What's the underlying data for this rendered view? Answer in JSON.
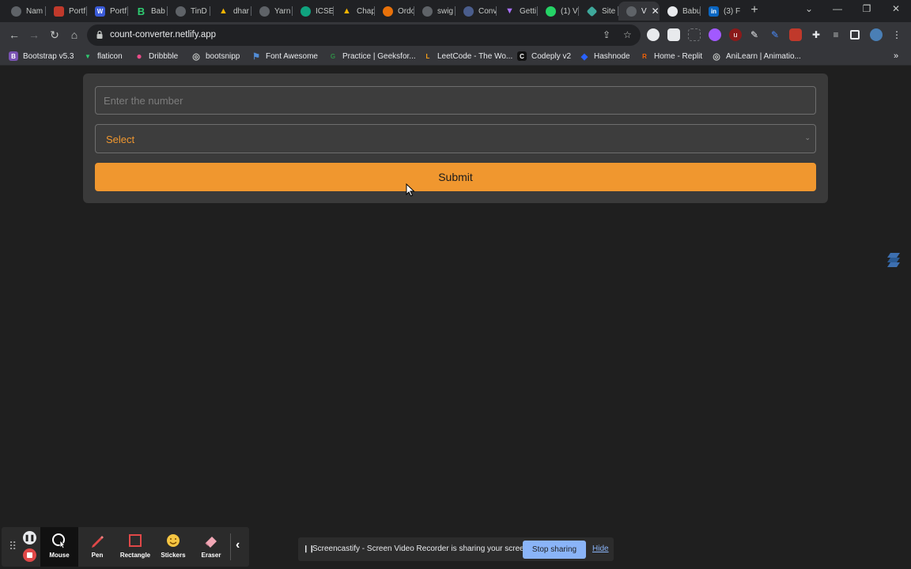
{
  "browser": {
    "tabs": [
      {
        "label": "Nam",
        "color": "#5f6368"
      },
      {
        "label": "Portf",
        "color": "#c0392b"
      },
      {
        "label": "Portf",
        "color": "#3a5bd9"
      },
      {
        "label": "Bab",
        "color": "#2ecc71"
      },
      {
        "label": "TinD",
        "color": "#5f6368"
      },
      {
        "label": "dhar",
        "color": "#f4b400"
      },
      {
        "label": "Yarn",
        "color": "#5f6368"
      },
      {
        "label": "ICSE",
        "color": "#10a37f"
      },
      {
        "label": "Chap",
        "color": "#f4b400"
      },
      {
        "label": "Ordo",
        "color": "#e8710a"
      },
      {
        "label": "swig",
        "color": "#5f6368"
      },
      {
        "label": "Conv",
        "color": "#4a5d8c"
      },
      {
        "label": "Getti",
        "color": "#8e44ad"
      },
      {
        "label": "(1) V",
        "color": "#25d366"
      },
      {
        "label": "Site",
        "color": "#3ea89b"
      },
      {
        "label": "V",
        "color": "#5f6368"
      },
      {
        "label": "Babu",
        "color": "#e8eaed"
      },
      {
        "label": "(3) F",
        "color": "#0a66c2"
      }
    ],
    "new_tab_label": "+",
    "url": "count-converter.netlify.app",
    "bookmarks": [
      {
        "label": "Bootstrap v5.3",
        "color": "#7952b3",
        "glyph": "B"
      },
      {
        "label": "flaticon",
        "color": "#2ecc71",
        "glyph": "▼"
      },
      {
        "label": "Dribbble",
        "color": "#ea4c89",
        "glyph": "●"
      },
      {
        "label": "bootsnipp",
        "color": "#5f6368",
        "glyph": "◎"
      },
      {
        "label": "Font Awesome",
        "color": "#528dd7",
        "glyph": "⚑"
      },
      {
        "label": "Practice | Geeksfor...",
        "color": "#2f8d46",
        "glyph": "G"
      },
      {
        "label": "LeetCode - The Wo...",
        "color": "#ffa116",
        "glyph": "L"
      },
      {
        "label": "Codeply v2",
        "color": "#111111",
        "glyph": "C"
      },
      {
        "label": "Hashnode",
        "color": "#2962ff",
        "glyph": "◆"
      },
      {
        "label": "Home - Replit",
        "color": "#f26207",
        "glyph": "R"
      },
      {
        "label": "AniLearn | Animatio...",
        "color": "#5f6368",
        "glyph": "◎"
      }
    ]
  },
  "form": {
    "number_placeholder": "Enter the number",
    "select_value": "Select",
    "submit_label": "Submit"
  },
  "recorder": {
    "tools": [
      {
        "label": "Mouse",
        "icon": "mouse-cursor-icon"
      },
      {
        "label": "Pen",
        "icon": "pen-icon"
      },
      {
        "label": "Rectangle",
        "icon": "rectangle-icon"
      },
      {
        "label": "Stickers",
        "icon": "smiley-sticker-icon"
      },
      {
        "label": "Eraser",
        "icon": "eraser-icon"
      }
    ],
    "share_text": "Screencastify - Screen Video Recorder is sharing your screen.",
    "stop_sharing_label": "Stop sharing",
    "hide_label": "Hide"
  },
  "colors": {
    "accent_orange": "#f0972f",
    "page_bg": "#1f1f1f",
    "card_bg": "#3a3a3a",
    "share_button": "#8ab4f8"
  }
}
